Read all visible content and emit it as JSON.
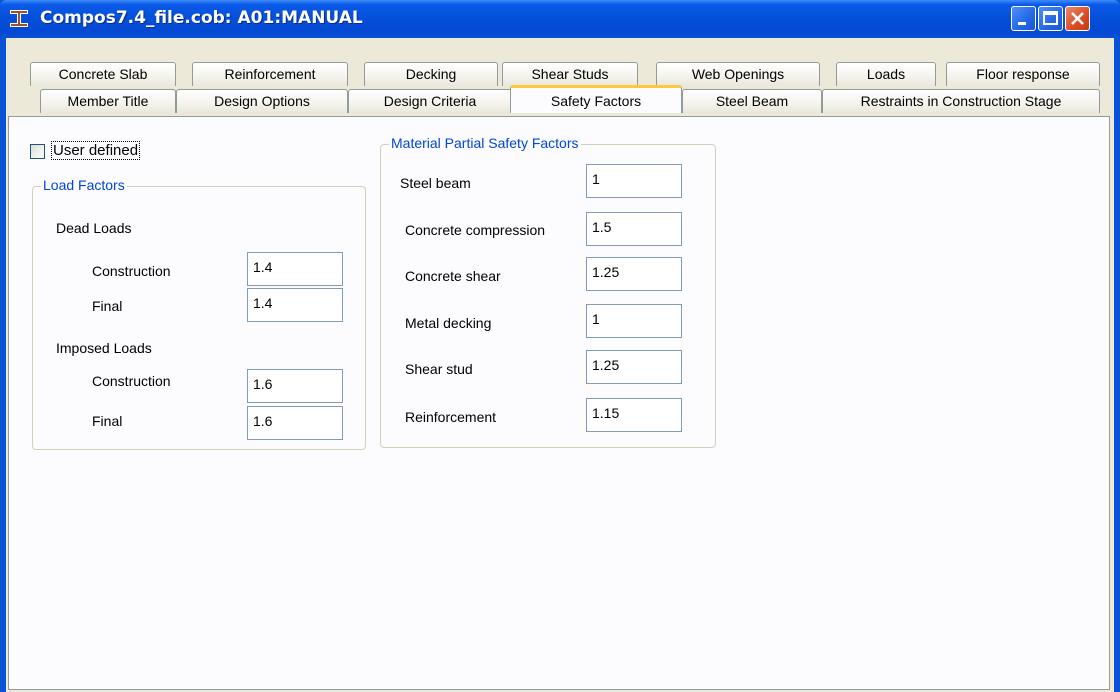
{
  "window": {
    "title": "Compos7.4_file.cob: A01:MANUAL",
    "controls": [
      "minimize-icon",
      "maximize-icon",
      "close-icon"
    ]
  },
  "tabs": {
    "row1": [
      "Concrete Slab",
      "Reinforcement",
      "Decking",
      "Shear Studs",
      "Web Openings",
      "Loads",
      "Floor response"
    ],
    "row2": [
      "Member Title",
      "Design Options",
      "Design Criteria",
      "Safety Factors",
      "Steel Beam",
      "Restraints in Construction Stage"
    ],
    "active": "Safety Factors"
  },
  "user_defined": {
    "label": "User defined",
    "checked": false
  },
  "load_factors": {
    "title": "Load Factors",
    "dead_loads": {
      "label": "Dead Loads",
      "construction_label": "Construction",
      "construction_value": "1.4",
      "final_label": "Final",
      "final_value": "1.4"
    },
    "imposed_loads": {
      "label": "Imposed Loads",
      "construction_label": "Construction",
      "construction_value": "1.6",
      "final_label": "Final",
      "final_value": "1.6"
    }
  },
  "material_factors": {
    "title": "Material Partial Safety Factors",
    "items": [
      {
        "label": "Steel beam",
        "value": "1"
      },
      {
        "label": "Concrete compression",
        "value": "1.5"
      },
      {
        "label": "Concrete shear",
        "value": "1.25"
      },
      {
        "label": "Metal decking",
        "value": "1"
      },
      {
        "label": "Shear stud",
        "value": "1.25"
      },
      {
        "label": "Reinforcement",
        "value": "1.15"
      }
    ]
  },
  "colors": {
    "title_bar": "#0a52d6",
    "group_title": "#0046d5",
    "active_tab_accent": "#ffc73c",
    "dialog_background": "#ece9d8"
  }
}
